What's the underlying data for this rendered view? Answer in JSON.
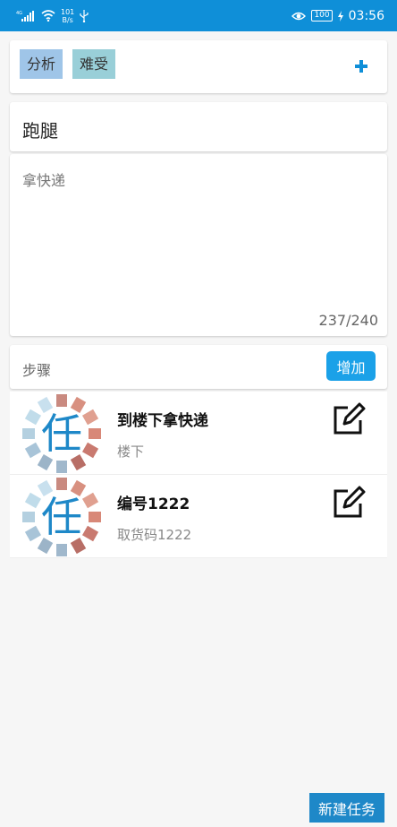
{
  "status_bar": {
    "signal_indicator": "4G",
    "net_speed": "101",
    "net_speed_unit": "B/s",
    "battery": "100",
    "time": "03:56"
  },
  "tags": [
    {
      "label": "分析",
      "color": "#9fc5e8"
    },
    {
      "label": "难受",
      "color": "#99cfd8"
    }
  ],
  "task": {
    "title": "跑腿",
    "description": "拿快递",
    "char_count": "237/240"
  },
  "steps_section": {
    "label": "步骤",
    "add_label": "增加"
  },
  "steps": [
    {
      "icon_char": "任",
      "title": "到楼下拿快递",
      "subtitle": "楼下"
    },
    {
      "icon_char": "任",
      "title": "编号1222",
      "subtitle": "取货码1222"
    }
  ],
  "new_task_label": "新建任务",
  "colors": {
    "accent": "#0f8fd8",
    "button": "#1ba1e8"
  }
}
